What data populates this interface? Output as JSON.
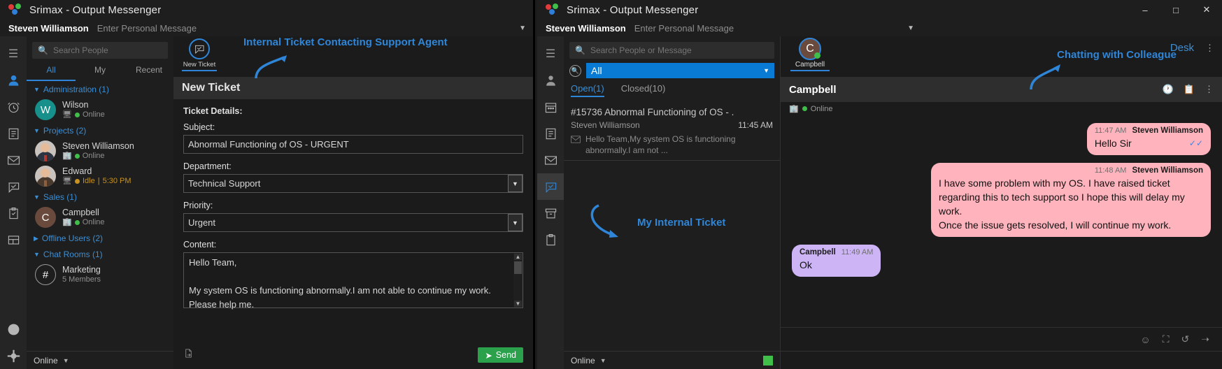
{
  "window1": {
    "title": "Srimax - Output Messenger",
    "user": {
      "name": "Steven Williamson",
      "personal_message": "Enter Personal Message"
    },
    "search": {
      "placeholder": "Search People",
      "icon": "search-icon"
    },
    "tabs": [
      {
        "label": "All",
        "active": true
      },
      {
        "label": "My",
        "active": false
      },
      {
        "label": "Recent",
        "active": false
      }
    ],
    "groups": [
      {
        "label": "Administration (1)",
        "expanded": true,
        "contacts": [
          {
            "name": "Wilson",
            "status": "Online",
            "initial": "W",
            "avatar": "teal"
          }
        ]
      },
      {
        "label": "Projects (2)",
        "expanded": true,
        "contacts": [
          {
            "name": "Steven Williamson",
            "status": "Online",
            "avatar": "photo"
          },
          {
            "name": "Edward",
            "status": "Idle",
            "time": "5:30 PM",
            "avatar": "photo2"
          }
        ]
      },
      {
        "label": "Sales (1)",
        "expanded": true,
        "contacts": [
          {
            "name": "Campbell",
            "status": "Online",
            "initial": "C",
            "avatar": "brown"
          }
        ]
      }
    ],
    "offline_users": "Offline Users (2)",
    "chat_rooms": {
      "label": "Chat Rooms (1)",
      "room_name": "Marketing",
      "members": "5 Members",
      "icon": "hash-icon"
    },
    "status": {
      "label": "Online"
    },
    "ticket": {
      "annotation": "Internal Ticket Contacting Support Agent",
      "tab_label": "New Ticket",
      "header": "New Ticket",
      "details_label": "Ticket Details:",
      "subject_label": "Subject:",
      "subject_value": "Abnormal Functioning of OS - URGENT",
      "department_label": "Department:",
      "department_value": "Technical Support",
      "priority_label": "Priority:",
      "priority_value": "Urgent",
      "content_label": "Content:",
      "content_line1": "Hello Team,",
      "content_line2": "My system OS is functioning abnormally.I am not able to continue my work. Please help me.",
      "attach_icon": "attach-file-icon",
      "send_label": "Send",
      "send_icon": "send-plane-icon"
    }
  },
  "window2": {
    "title": "Srimax - Output Messenger",
    "user": {
      "name": "Steven Williamson",
      "personal_message": "Enter Personal Message"
    },
    "search": {
      "placeholder": "Search People or Message",
      "icon": "search-icon"
    },
    "filter": {
      "selected": "All",
      "desk_label": "Desk"
    },
    "ticket_tabs": [
      {
        "label": "Open(1)",
        "active": true
      },
      {
        "label": "Closed(10)",
        "active": false
      }
    ],
    "ticket_item": {
      "id": "#15736",
      "subject": "Abnormal Functioning of OS - .",
      "sender": "Steven Williamson",
      "time": "11:45 AM",
      "preview": "Hello Team,My system OS is functioning abnormally.I am not ...",
      "mail_icon": "mail-icon"
    },
    "annotation_list": "My Internal Ticket",
    "annotation_chat": "Chatting with Colleague",
    "chat": {
      "tab_name": "Campbell",
      "name": "Campbell",
      "status": "Online",
      "header_icons": [
        "history-icon",
        "clipboard-icon",
        "kebab-icon"
      ],
      "messages": [
        {
          "side": "right",
          "color": "pink",
          "time": "11:47 AM",
          "sender": "Steven Williamson",
          "text": "Hello Sir",
          "read": true
        },
        {
          "side": "right",
          "color": "pink",
          "time": "11:48 AM",
          "sender": "Steven Williamson",
          "text": "I have some problem with my OS. I have raised ticket regarding this to tech support so I hope this will delay my work.\nOnce the issue gets resolved, I will continue my work.",
          "read": false
        },
        {
          "side": "left",
          "color": "purple",
          "time": "11:49 AM",
          "sender": "Campbell",
          "text": "Ok",
          "read": false
        }
      ],
      "composer_icons": [
        "emoji-icon",
        "screenshot-icon",
        "voice-icon",
        "send-icon"
      ]
    },
    "status": {
      "label": "Online"
    },
    "window_controls": {
      "minimize": "–",
      "maximize": "□",
      "close": "✕"
    }
  },
  "colors": {
    "accent": "#2f86d8",
    "pink": "#ffb3bd",
    "purple": "#cdb4f5",
    "green": "#2ba14b",
    "blue_sel": "#0a7bd4"
  }
}
